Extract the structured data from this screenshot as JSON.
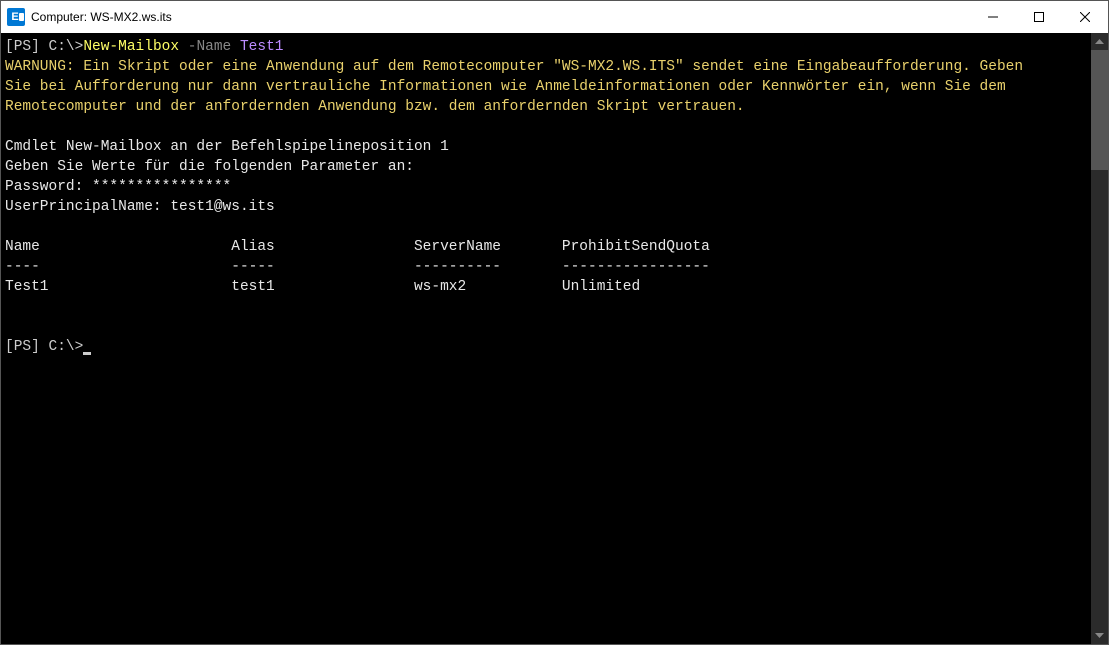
{
  "window": {
    "title": "Computer: WS-MX2.ws.its"
  },
  "terminal": {
    "line1": {
      "prompt": "[PS] C:\\>",
      "cmd": "New-Mailbox",
      "param": " -Name",
      "arg": " Test1"
    },
    "warning_l1": "WARNUNG: Ein Skript oder eine Anwendung auf dem Remotecomputer \"WS-MX2.WS.ITS\" sendet eine Eingabeaufforderung. Geben ",
    "warning_l2": "Sie bei Aufforderung nur dann vertrauliche Informationen wie Anmeldeinformationen oder Kennwörter ein, wenn Sie dem ",
    "warning_l3": "Remotecomputer und der anfordernden Anwendung bzw. dem anfordernden Skript vertrauen.",
    "blank": "",
    "info1": "Cmdlet New-Mailbox an der Befehlspipelineposition 1",
    "info2": "Geben Sie Werte für die folgenden Parameter an:",
    "password": "Password: ****************",
    "upn": "UserPrincipalName: test1@ws.its",
    "table_header": "Name                      Alias                ServerName       ProhibitSendQuota",
    "table_sep": "----                      -----                ----------       -----------------",
    "table_row": "Test1                     test1                ws-mx2           Unlimited",
    "prompt2": "[PS] C:\\>"
  }
}
